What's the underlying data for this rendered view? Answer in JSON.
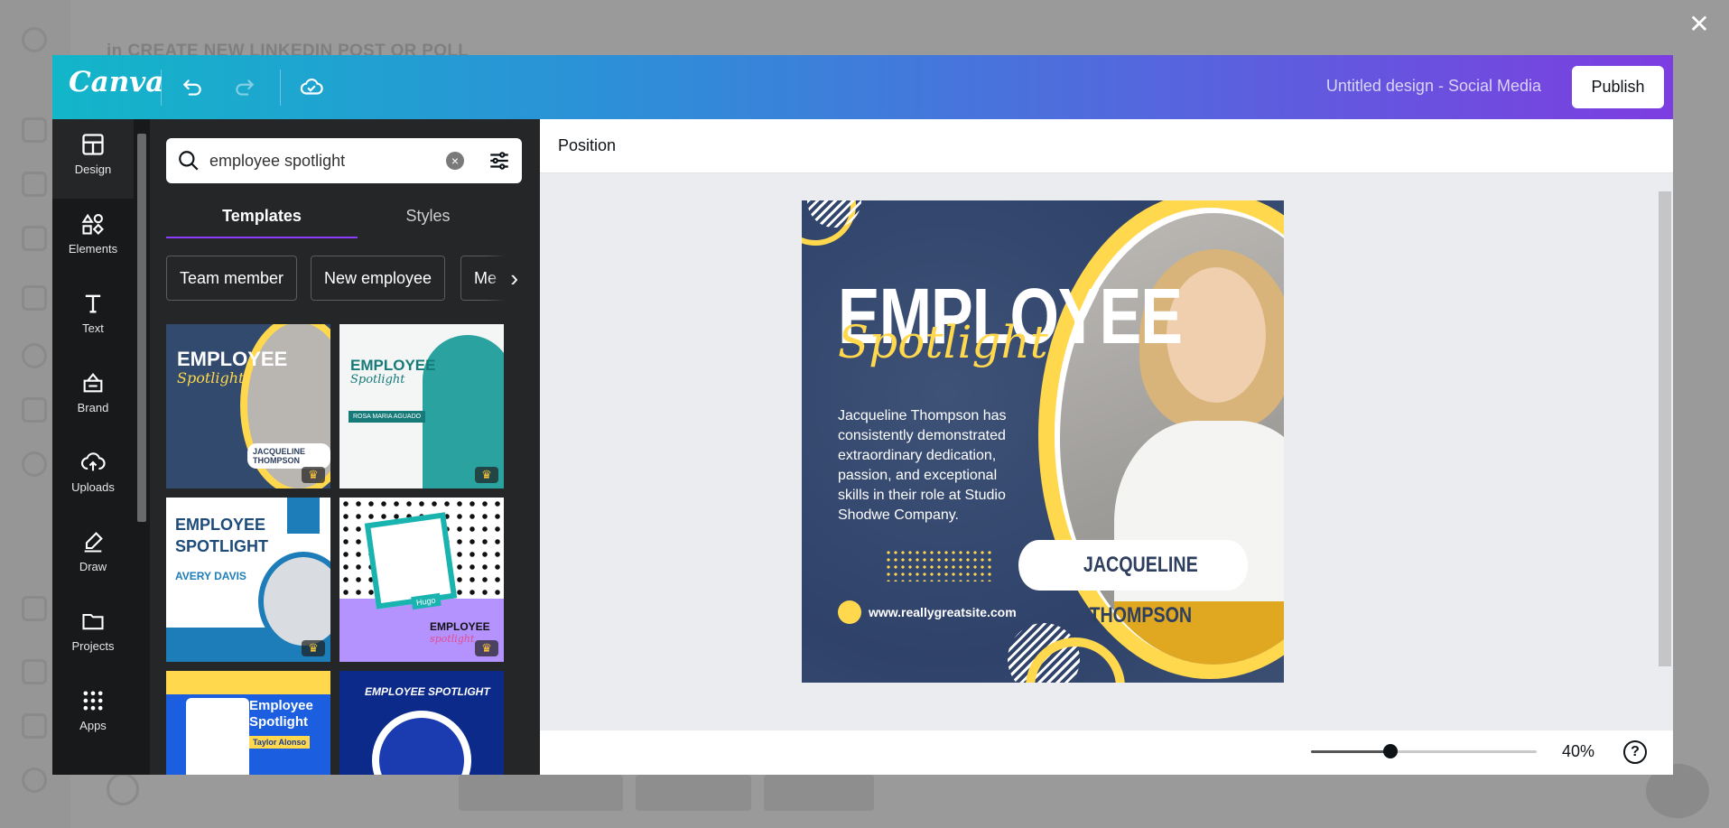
{
  "background": {
    "header": "CREATE NEW LINKEDIN POST OR POLL",
    "header_prefix": "in"
  },
  "close_glyph": "✕",
  "canva": {
    "logo": "Canva",
    "design_title": "Untitled design - Social Media",
    "publish_label": "Publish",
    "rail": [
      {
        "label": "Design",
        "icon": "layout-icon"
      },
      {
        "label": "Elements",
        "icon": "shapes-icon"
      },
      {
        "label": "Text",
        "icon": "text-icon"
      },
      {
        "label": "Brand",
        "icon": "brand-icon"
      },
      {
        "label": "Uploads",
        "icon": "cloud-upload-icon"
      },
      {
        "label": "Draw",
        "icon": "pen-icon"
      },
      {
        "label": "Projects",
        "icon": "folder-icon"
      },
      {
        "label": "Apps",
        "icon": "apps-grid-icon"
      }
    ],
    "search": {
      "value": "employee spotlight",
      "placeholder": "Search"
    },
    "tabs": [
      "Templates",
      "Styles"
    ],
    "chips": [
      "Team member",
      "New employee",
      "Me"
    ],
    "templates": [
      {
        "title": "EMPLOYEE",
        "subtitle": "Spotlight",
        "name": "JACQUELINE THOMPSON",
        "premium": true,
        "palette": "#324a6e"
      },
      {
        "title": "EMPLOYEE",
        "subtitle": "Spotlight",
        "name": "ROSA MARIA AGUADO",
        "premium": true,
        "palette": "#f3f6f5"
      },
      {
        "title": "EMPLOYEE SPOTLIGHT",
        "subtitle": "",
        "name": "AVERY DAVIS",
        "premium": true,
        "palette": "#ffffff"
      },
      {
        "title": "EMPLOYEE",
        "subtitle": "spotlight",
        "name": "Hugo",
        "premium": true,
        "palette": "#b493ff"
      },
      {
        "title": "Employee Spotlight",
        "subtitle": "",
        "name": "Taylor Alonso",
        "premium": false,
        "palette": "#1b5fe0"
      },
      {
        "title": "EMPLOYEE SPOTLIGHT",
        "subtitle": "",
        "name": "",
        "premium": false,
        "palette": "#0b2a8a"
      }
    ],
    "toolbar_position": "Position",
    "design": {
      "title": "EMPLOYEE",
      "script": "Spotlight",
      "body": "Jacqueline Thompson has consistently demonstrated extraordinary dedication, passion, and exceptional skills in their role at Studio Shodwe Company.",
      "name": "JACQUELINE THOMPSON",
      "website": "www.reallygreatsite.com"
    },
    "zoom": {
      "value": "40%",
      "fraction": 0.35
    },
    "help": "?"
  },
  "colors": {
    "accent": "#8b3dff",
    "yellow": "#ffd84d",
    "navy": "#2f426a"
  }
}
